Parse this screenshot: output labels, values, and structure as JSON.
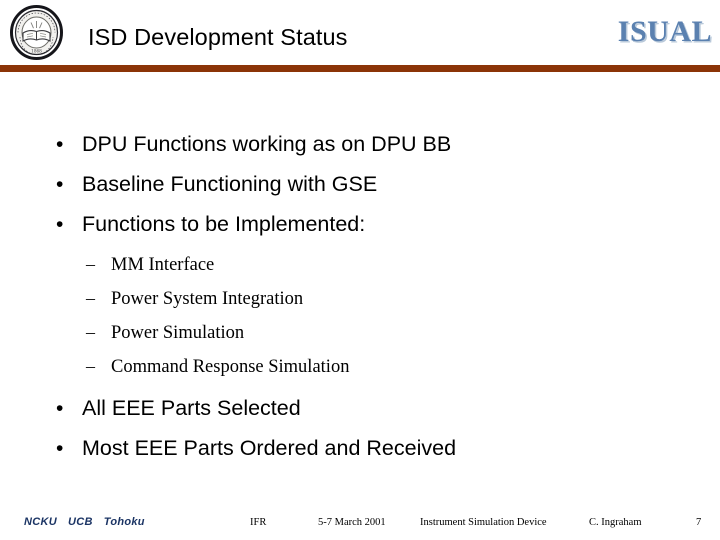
{
  "header": {
    "title": "ISD Development Status",
    "logo_text": "ISUAL",
    "seal_name": "university-seal",
    "rule_color": "#8b3407",
    "logo_color": "#5b81b0"
  },
  "content": {
    "bullets": [
      {
        "level": 1,
        "marker": "•",
        "text": "DPU Functions working as on DPU BB"
      },
      {
        "level": 1,
        "marker": "•",
        "text": "Baseline Functioning with GSE"
      },
      {
        "level": 1,
        "marker": "•",
        "text": "Functions to be Implemented:"
      },
      {
        "level": 2,
        "marker": "–",
        "text": "MM Interface"
      },
      {
        "level": 2,
        "marker": "–",
        "text": "Power System Integration"
      },
      {
        "level": 2,
        "marker": "–",
        "text": "Power Simulation"
      },
      {
        "level": 2,
        "marker": "–",
        "text": "Command Response Simulation"
      },
      {
        "level": 1,
        "marker": "•",
        "text": "All EEE Parts Selected"
      },
      {
        "level": 1,
        "marker": "•",
        "text": "Most EEE Parts Ordered and Received"
      }
    ]
  },
  "footer": {
    "organizations": [
      "NCKU",
      "UCB",
      "Tohoku"
    ],
    "org_color": "#1b3464",
    "meeting": "IFR",
    "date": "5-7 March 2001",
    "subject": "Instrument Simulation Device",
    "author": "C. Ingraham",
    "page_number": "7"
  }
}
